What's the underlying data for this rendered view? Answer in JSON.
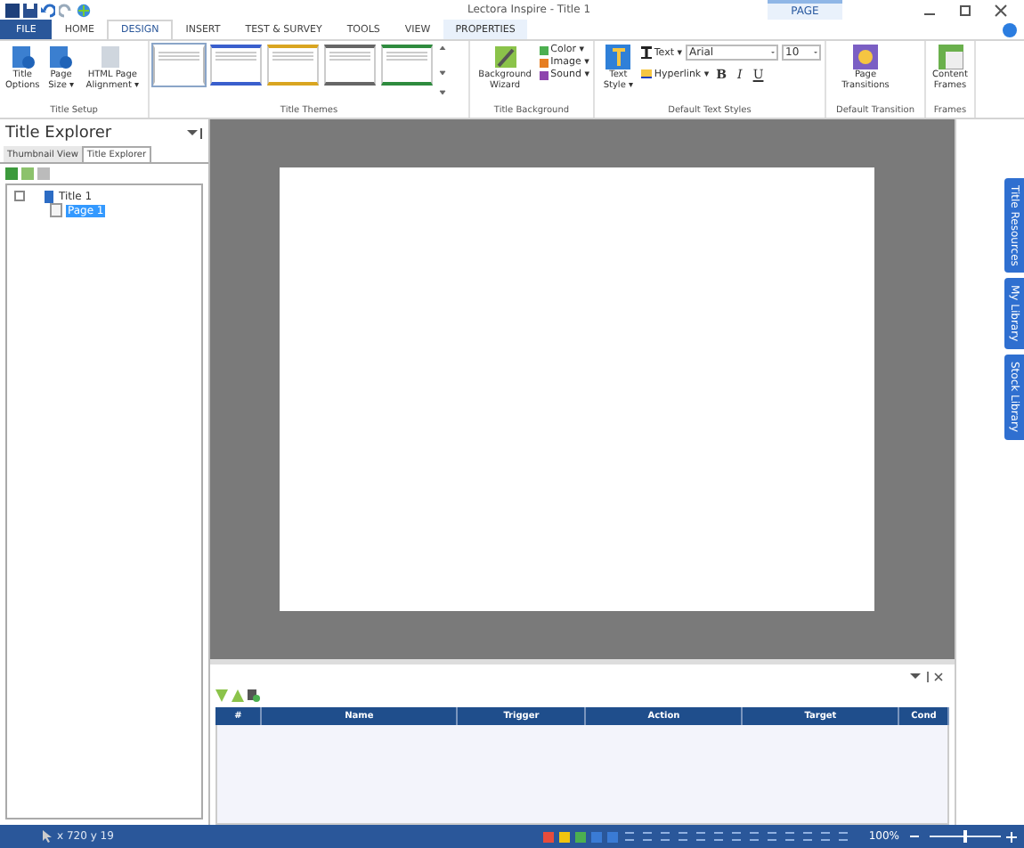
{
  "window": {
    "title": "Lectora Inspire - Title 1",
    "context_label": "PAGE"
  },
  "tabs": [
    {
      "label": "FILE",
      "kind": "file",
      "selected": false
    },
    {
      "label": "HOME",
      "kind": "tab",
      "selected": false
    },
    {
      "label": "DESIGN",
      "kind": "tab",
      "selected": true
    },
    {
      "label": "INSERT",
      "kind": "tab",
      "selected": false
    },
    {
      "label": "TEST & SURVEY",
      "kind": "tab",
      "selected": false
    },
    {
      "label": "TOOLS",
      "kind": "tab",
      "selected": false
    },
    {
      "label": "VIEW",
      "kind": "tab",
      "selected": false
    },
    {
      "label": "PROPERTIES",
      "kind": "context",
      "selected": false
    }
  ],
  "ribbon": {
    "title_setup": {
      "label": "Title Setup",
      "buttons": [
        "Title Options",
        "Page Size ▾",
        "HTML Page Alignment ▾"
      ]
    },
    "title_themes": {
      "label": "Title Themes",
      "themes": [
        {
          "color": "#ffffff",
          "selected": true
        },
        {
          "color": "#3a5fcd",
          "selected": false
        },
        {
          "color": "#d9a520",
          "selected": false
        },
        {
          "color": "#666666",
          "selected": false
        },
        {
          "color": "#2e8b3e",
          "selected": false
        }
      ]
    },
    "title_background": {
      "label": "Title Background",
      "wizard": "Background Wizard",
      "items": [
        "Color ▾",
        "Image ▾",
        "Sound ▾"
      ]
    },
    "text_styles": {
      "label": "Default Text Styles",
      "style_button": "Text Style ▾",
      "text": "Text ▾",
      "hyperlink": "Hyperlink ▾",
      "font": "Arial",
      "size": "10",
      "bold": "B",
      "italic": "I",
      "underline": "U"
    },
    "transition": {
      "label": "Default Transition",
      "button": "Page Transitions"
    },
    "frames": {
      "label": "Frames",
      "button": "Content Frames"
    }
  },
  "explorer": {
    "title": "Title Explorer",
    "tabs": [
      {
        "label": "Thumbnail View",
        "selected": false
      },
      {
        "label": "Title Explorer",
        "selected": true
      }
    ],
    "tree": [
      {
        "label": "Title 1",
        "kind": "title",
        "selected": false,
        "children": [
          {
            "label": "Page 1",
            "kind": "page",
            "selected": true
          }
        ]
      }
    ]
  },
  "side_tabs": [
    "Title Resources",
    "My Library",
    "Stock Library"
  ],
  "actions_table": {
    "columns": [
      "#",
      "Name",
      "Trigger",
      "Action",
      "Target",
      "Cond"
    ]
  },
  "status_bar": {
    "position": "x 720 y 19",
    "zoom": "100%",
    "zoom_slider": {
      "level": 0.5
    }
  }
}
